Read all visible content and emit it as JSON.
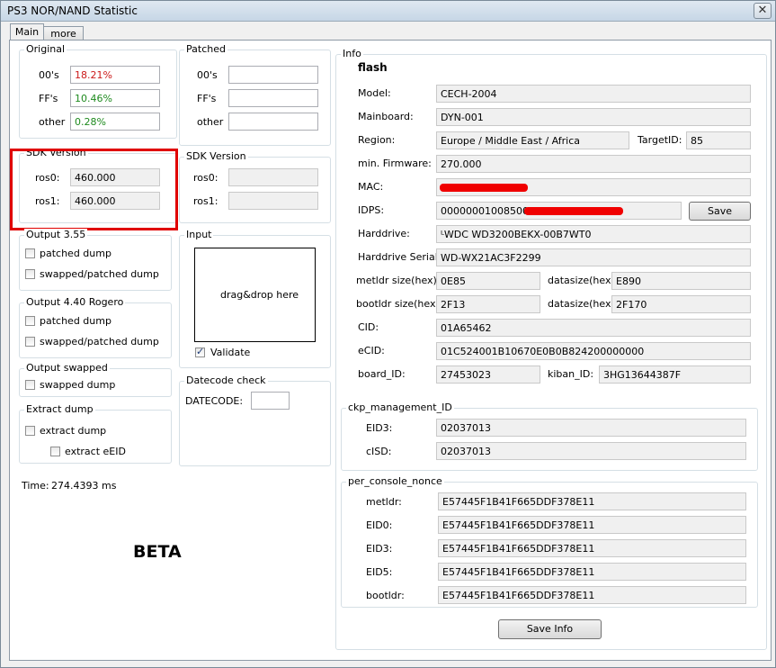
{
  "window": {
    "title": "PS3 NOR/NAND Statistic",
    "close_glyph": "✕"
  },
  "tabs": [
    {
      "label": "Main"
    },
    {
      "label": "more"
    }
  ],
  "original": {
    "title": "Original",
    "rows": [
      {
        "label": "00's",
        "value": "18.21%",
        "color": "#cc1a1a"
      },
      {
        "label": "FF's",
        "value": "10.46%",
        "color": "#1e8a1e"
      },
      {
        "label": "other",
        "value": "0.28%",
        "color": "#1e8a1e"
      }
    ]
  },
  "patched": {
    "title": "Patched",
    "rows": [
      {
        "label": "00's",
        "value": ""
      },
      {
        "label": "FF's",
        "value": ""
      },
      {
        "label": "other",
        "value": ""
      }
    ]
  },
  "sdk_left": {
    "title": "SDK Version",
    "ros0_label": "ros0:",
    "ros0": "460.000",
    "ros1_label": "ros1:",
    "ros1": "460.000"
  },
  "sdk_right": {
    "title": "SDK Version",
    "ros0_label": "ros0:",
    "ros0": "",
    "ros1_label": "ros1:",
    "ros1": ""
  },
  "output355": {
    "title": "Output 3.55",
    "patched": "patched dump",
    "swapped": "swapped/patched dump"
  },
  "output440": {
    "title": "Output 4.40 Rogero",
    "patched": "patched dump",
    "swapped": "swapped/patched dump"
  },
  "output_swapped": {
    "title": "Output swapped",
    "swapped": "swapped dump"
  },
  "extract": {
    "title": "Extract dump",
    "dump": "extract dump",
    "eeid": "extract eEID"
  },
  "input": {
    "title": "Input",
    "drop_text": "drag&drop here",
    "validate": "Validate",
    "validate_checked": true
  },
  "datecode": {
    "title": "Datecode check",
    "label": "DATECODE:",
    "value": ""
  },
  "time": {
    "label": "Time:",
    "value": "274.4393 ms"
  },
  "beta": "BETA",
  "info": {
    "title": "Info",
    "flash": "flash",
    "model_label": "Model:",
    "model": "CECH-2004",
    "mainboard_label": "Mainboard:",
    "mainboard": "DYN-001",
    "region_label": "Region:",
    "region": "Europe / Middle East / Africa",
    "target_label": "TargetID:",
    "target": "85",
    "firmware_label": "min. Firmware:",
    "firmware": "270.000",
    "mac_label": "MAC:",
    "mac": "",
    "idps_label": "IDPS:",
    "idps": "0000000100850000",
    "save_label": "Save",
    "hdd_label": "Harddrive:",
    "hdd": "ᴸWDC WD3200BEKX-00B7WT0",
    "hdd_serial_label": "Harddrive Serial:",
    "hdd_serial": "WD-WX21AC3F2299",
    "metldr_size_label": "metldr size(hex):",
    "metldr_size": "0E85",
    "datasize1_label": "datasize(hex):",
    "datasize1": "E890",
    "bootldr_size_label": "bootldr size(hex):",
    "bootldr_size": "2F13",
    "datasize2_label": "datasize(hex):",
    "datasize2": "2F170",
    "cid_label": "CID:",
    "cid": "01A65462",
    "ecid_label": "eCID:",
    "ecid": "01C524001B10670E0B0B824200000000",
    "board_label": "board_ID:",
    "board": "27453023",
    "kiban_label": "kiban_ID:",
    "kiban": "3HG13644387F"
  },
  "ckp": {
    "title": "ckp_management_ID",
    "eid3_label": "EID3:",
    "eid3": "02037013",
    "cisd_label": "cISD:",
    "cisd": "02037013"
  },
  "nonce": {
    "title": "per_console_nonce",
    "rows": [
      {
        "label": "metldr:",
        "value": "E57445F1B41F665DDF378E11"
      },
      {
        "label": "EID0:",
        "value": "E57445F1B41F665DDF378E11"
      },
      {
        "label": "EID3:",
        "value": "E57445F1B41F665DDF378E11"
      },
      {
        "label": "EID5:",
        "value": "E57445F1B41F665DDF378E11"
      },
      {
        "label": "bootldr:",
        "value": "E57445F1B41F665DDF378E11"
      }
    ]
  },
  "save_info_label": "Save Info",
  "colors": {
    "highlight": "#e00000",
    "redaction": "#f00000"
  }
}
